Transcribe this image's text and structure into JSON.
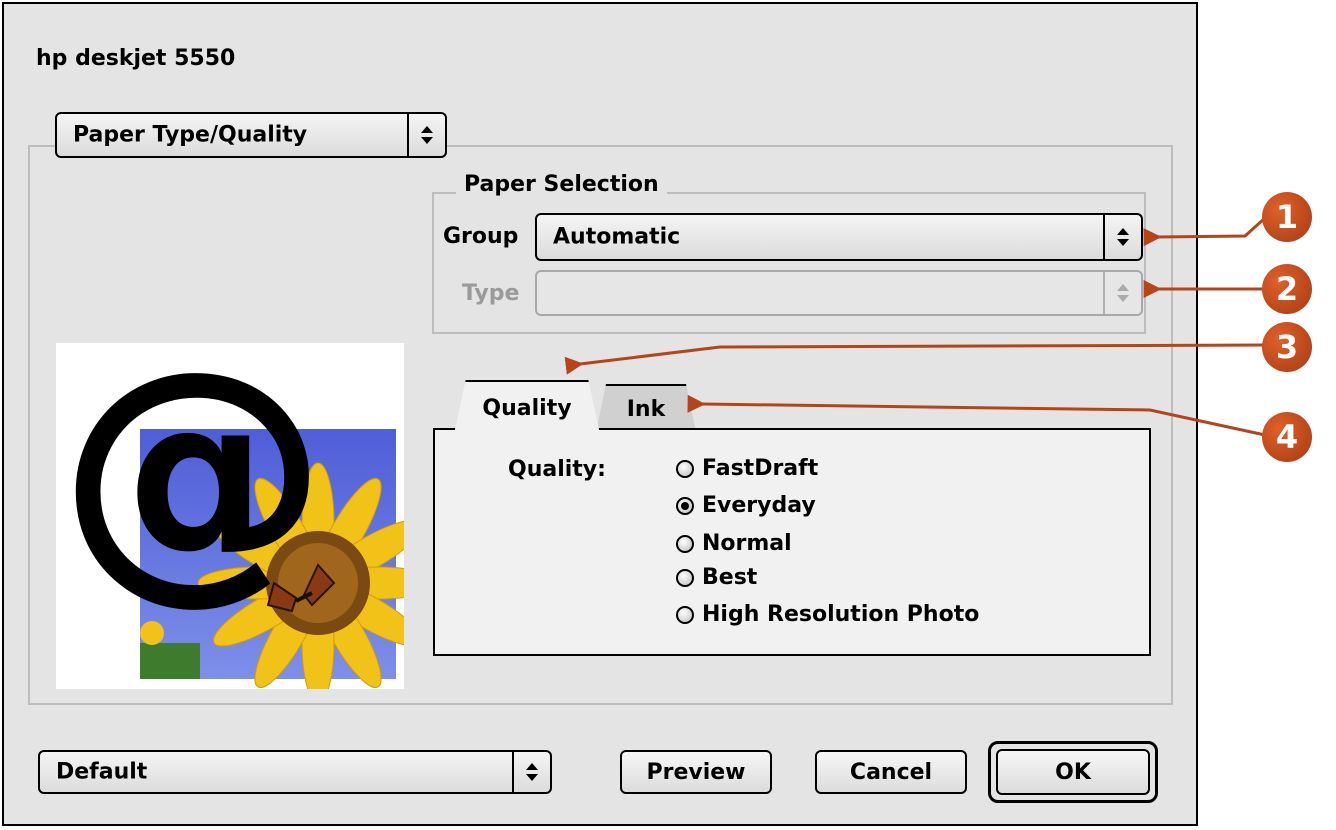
{
  "dialog": {
    "title": "hp deskjet 5550"
  },
  "panel_popup": {
    "label": "Paper Type/Quality"
  },
  "paper_selection": {
    "legend": "Paper Selection",
    "group_label": "Group",
    "group_value": "Automatic",
    "type_label": "Type",
    "type_value": ""
  },
  "tabs": {
    "quality": "Quality",
    "ink": "Ink"
  },
  "quality": {
    "label": "Quality:",
    "options": [
      "FastDraft",
      "Everyday",
      "Normal",
      "Best",
      "High Resolution Photo"
    ],
    "selected": "Everyday"
  },
  "footer": {
    "preset_value": "Default",
    "preview": "Preview",
    "cancel": "Cancel",
    "ok": "OK"
  },
  "callouts": [
    "1",
    "2",
    "3",
    "4"
  ],
  "colors": {
    "callout": "#c2471a",
    "arrow": "#b5441a"
  }
}
